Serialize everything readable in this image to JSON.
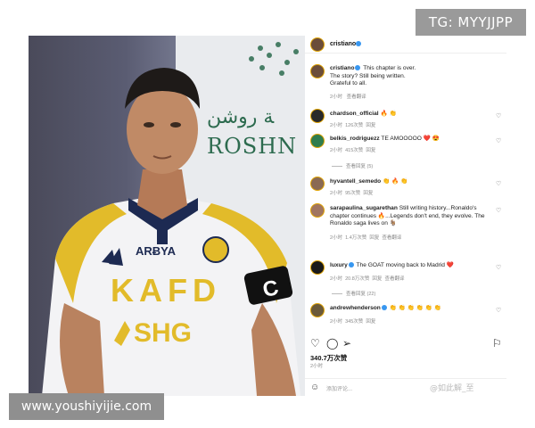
{
  "watermarks": {
    "top": "TG: MYYJJPP",
    "bottom": "www.youshiyijie.com"
  },
  "photo": {
    "banner_arabic": "ﺔ روشن",
    "banner_latin": "ROSHN C",
    "jersey_sponsor_top": "ARɃYA",
    "jersey_main": "KAFD",
    "jersey_bottom": "SHG",
    "armband": "C"
  },
  "post": {
    "owner": "cristiano",
    "caption_user": "cristiano",
    "caption_lines": [
      "This chapter is over.",
      "The story? Still being written.",
      "Grateful to all."
    ],
    "caption_time": "2小时",
    "caption_translate": "查看翻译",
    "comments": [
      {
        "user": "chardson_official",
        "text": "🔥 👏",
        "time": "2小时",
        "likes": "126次赞",
        "reply": "回复",
        "translate": "",
        "more": ""
      },
      {
        "user": "belkis_rodriguezz",
        "text": "TE AMOOOOO ❤️ 😍",
        "time": "2小时",
        "likes": "415次赞",
        "reply": "回复",
        "translate": "",
        "more": "查看回复 (5)"
      },
      {
        "user": "hyvantell_semedo",
        "text": "👏 🔥 👏",
        "time": "2小时",
        "likes": "95次赞",
        "reply": "回复",
        "translate": "",
        "more": ""
      },
      {
        "user": "sarapaulina_sugarethan",
        "text": "Still writing history...Ronaldo's chapter continues 🔥...Legends don't end, they evolve. The Ronaldo saga lives on 🐐",
        "time": "2小时",
        "likes": "1.4万次赞",
        "reply": "回复",
        "translate": "查看翻译",
        "more": ""
      },
      {
        "user": "luxury",
        "text": "The GOAT moving back to Madrid ❤️",
        "time": "2小时",
        "likes": "20.8万次赞",
        "reply": "回复",
        "translate": "查看翻译",
        "more": "查看回复 (22)"
      },
      {
        "user": "andrewhenderson",
        "text": "👏 👏 👏 👏 👏 👏",
        "time": "2小时",
        "likes": "345次赞",
        "reply": "回复",
        "translate": "",
        "more": ""
      }
    ],
    "likes_total": "340.7万次赞",
    "posted_ago": "2小时",
    "comment_placeholder": "添加评论...",
    "weibo_mark": "@如此解_至"
  },
  "icons": [
    "heart-icon",
    "comment-icon",
    "share-icon",
    "bookmark-icon",
    "smile-icon",
    "verified-icon"
  ],
  "colors": {
    "accent_verified": "#3897f0",
    "jersey_gold": "#e2bb2a",
    "collar_navy": "#1d2a52"
  }
}
